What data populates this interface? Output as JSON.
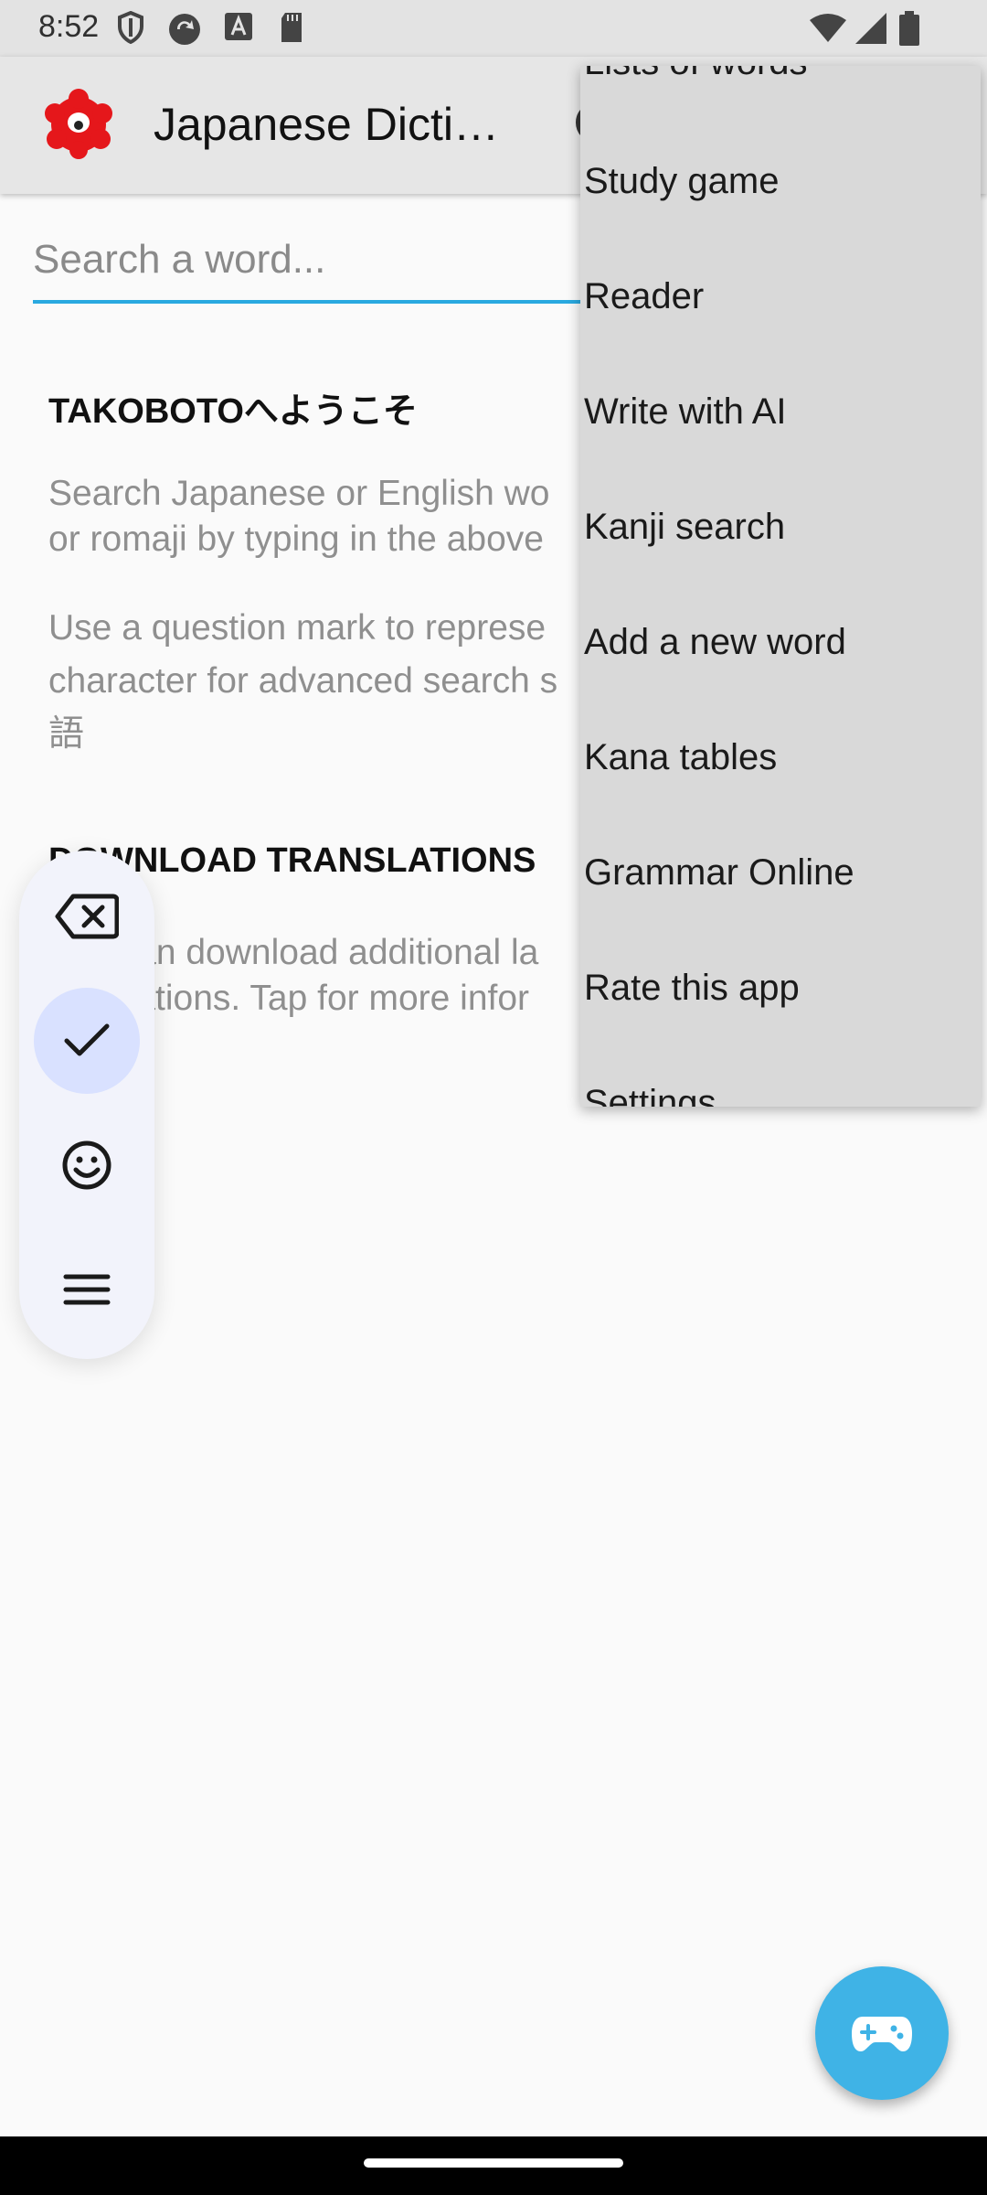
{
  "status_bar": {
    "time": "8:52"
  },
  "app_bar": {
    "title": "Japanese Dicti…"
  },
  "search": {
    "placeholder": "Search a word..."
  },
  "welcome": {
    "title": "TAKOBOTOへようこそ",
    "line1": "Search Japanese or English wo",
    "line2": "or romaji by typing in the above",
    "line3": "Use a question mark to represe",
    "line4": "character for advanced search s",
    "line5": "語"
  },
  "download": {
    "title": "DOWNLOAD TRANSLATIONS",
    "line1": "You can download additional la",
    "line2": "translations. Tap for more infor"
  },
  "overflow_menu": {
    "items": [
      "Lists of words",
      "Study game",
      "Reader",
      "Write with AI",
      "Kanji search",
      "Add a new word",
      "Kana tables",
      "Grammar Online",
      "Rate this app",
      "Settings"
    ]
  },
  "keyboard_toolbar": {
    "icons": [
      "backspace-icon",
      "check-icon",
      "emoji-icon",
      "menu-icon"
    ],
    "selected": "check-icon"
  },
  "colors": {
    "accent": "#29a9e0",
    "fab": "#3fb3e6",
    "logo": "#e5171b",
    "menu_bg": "#d9d9d9",
    "toolbar_selected": "#d9e1ff"
  }
}
